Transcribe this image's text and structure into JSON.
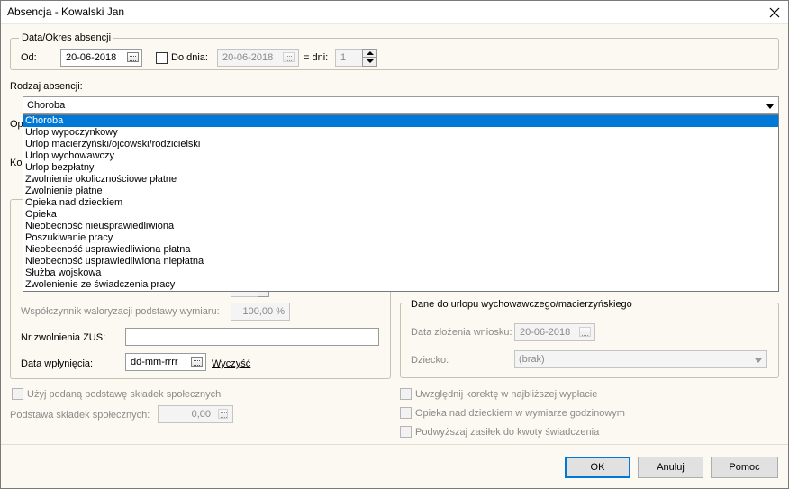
{
  "window": {
    "title": "Absencja - Kowalski Jan",
    "close_icon": "close-icon"
  },
  "period": {
    "legend": "Data/Okres absencji",
    "from_label": "Od:",
    "from_value": "20-06-2018",
    "to_checkbox_label": "Do dnia:",
    "to_checked": false,
    "to_value": "20-06-2018",
    "days_label": "= dni:",
    "days_value": "1"
  },
  "type": {
    "label": "Rodzaj absencji:",
    "selected": "Choroba",
    "options": [
      "Choroba",
      "Urlop wypoczynkowy",
      "Urlop macierzyński/ojcowski/rodzicielski",
      "Urlop wychowawczy",
      "Urlop bezpłatny",
      "Zwolnienie okolicznościowe płatne",
      "Zwolnienie płatne",
      "Opieka nad dzieckiem",
      "Opieka",
      "Nieobecność nieusprawiedliwiona",
      "Poszukiwanie pracy",
      "Nieobecność usprawiedliwiona płatna",
      "Nieobecność usprawiedliwiona niepłatna",
      "Służba wojskowa",
      "Zwolenienie ze świadczenia pracy"
    ]
  },
  "hidden_labels": {
    "op": "Op",
    "ko": "Ko"
  },
  "left_group": {
    "valorization_label": "Współczynnik waloryzacji podstawy wymiaru:",
    "valorization_value": "100,00 %",
    "zus_label": "Nr zwolnienia ZUS:",
    "zus_value": "",
    "date_label": "Data wpłynięcia:",
    "date_value": "dd-mm-rrrr",
    "clear_link": "Wyczyść"
  },
  "right_group": {
    "legend": "Dane do urlopu wychowawczego/macierzyńskiego",
    "request_date_label": "Data złożenia wniosku:",
    "request_date_value": "20-06-2018",
    "child_label": "Dziecko:",
    "child_value": "(brak)"
  },
  "bottom_left": {
    "use_basis_label": "Użyj podaną podstawę składek społecznych",
    "basis_label": "Podstawa składek społecznych:",
    "basis_value": "0,00"
  },
  "bottom_right": {
    "correction_label": "Uwzględnij korektę w najbliższej wypłacie",
    "care_hours_label": "Opieka nad dzieckiem w wymiarze godzinowym",
    "increase_label": "Podwyższaj zasiłek do kwoty świadczenia"
  },
  "buttons": {
    "ok": "OK",
    "cancel": "Anuluj",
    "help": "Pomoc"
  },
  "colors": {
    "selection": "#0078d7",
    "background": "#fbf9f1"
  }
}
